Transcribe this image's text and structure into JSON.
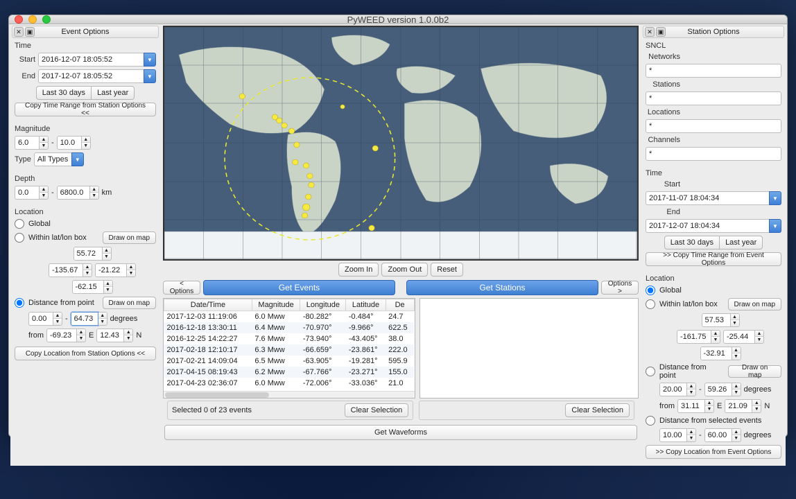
{
  "window": {
    "title": "PyWEED version 1.0.0b2"
  },
  "event": {
    "panel_title": "Event Options",
    "time_title": "Time",
    "start_label": "Start",
    "start_value": "2016-12-07 18:05:52",
    "end_label": "End",
    "end_value": "2017-12-07 18:05:52",
    "last30": "Last 30 days",
    "lastyear": "Last year",
    "copy_time": "Copy Time Range from Station Options <<",
    "mag_title": "Magnitude",
    "mag_min": "6.0",
    "mag_max": "10.0",
    "type_label": "Type",
    "type_value": "All Types",
    "depth_title": "Depth",
    "depth_min": "0.0",
    "depth_max": "6800.0",
    "depth_unit": "km",
    "loc_title": "Location",
    "global": "Global",
    "within": "Within lat/lon box",
    "draw": "Draw on map",
    "box_n": "55.72",
    "box_w": "-135.67",
    "box_e": "-21.22",
    "box_s": "-62.15",
    "dist_label": "Distance from point",
    "dist_min": "0.00",
    "dist_max": "64.73",
    "degrees": "degrees",
    "from": "from",
    "lat": "-69.23",
    "lon": "12.43",
    "E": "E",
    "N": "N",
    "copy_loc": "Copy Location from Station Options <<",
    "dash": "-"
  },
  "center": {
    "zoom_in": "Zoom In",
    "zoom_out": "Zoom Out",
    "reset": "Reset",
    "options_l": "< Options",
    "options_r": "Options >",
    "get_events": "Get Events",
    "get_stations": "Get Stations",
    "headers": [
      "Date/Time",
      "Magnitude",
      "Longitude",
      "Latitude",
      "De"
    ],
    "rows": [
      [
        "2017-12-03 11:19:06",
        "6.0 Mww",
        "-80.282°",
        "-0.484°",
        "24.7"
      ],
      [
        "2016-12-18 13:30:11",
        "6.4 Mww",
        "-70.970°",
        "-9.966°",
        "622.5"
      ],
      [
        "2016-12-25 14:22:27",
        "7.6 Mww",
        "-73.940°",
        "-43.405°",
        "38.0"
      ],
      [
        "2017-02-18 12:10:17",
        "6.3 Mww",
        "-66.659°",
        "-23.861°",
        "222.0"
      ],
      [
        "2017-02-21 14:09:04",
        "6.5 Mww",
        "-63.905°",
        "-19.281°",
        "595.9"
      ],
      [
        "2017-04-15 08:19:43",
        "6.2 Mww",
        "-67.766°",
        "-23.271°",
        "155.0"
      ],
      [
        "2017-04-23 02:36:07",
        "6.0 Mww",
        "-72.006°",
        "-33.036°",
        "21.0"
      ]
    ],
    "selected": "Selected 0 of 23 events",
    "clear": "Clear Selection",
    "get_wave": "Get Waveforms"
  },
  "station": {
    "panel_title": "Station Options",
    "sncl_title": "SNCL",
    "networks": "Networks",
    "networks_v": "*",
    "stations": "Stations",
    "stations_v": "*",
    "locations": "Locations",
    "locations_v": "*",
    "channels": "Channels",
    "channels_v": "*",
    "time_title": "Time",
    "start_label": "Start",
    "start_value": "2017-11-07 18:04:34",
    "end_label": "End",
    "end_value": "2017-12-07 18:04:34",
    "last30": "Last 30 days",
    "lastyear": "Last year",
    "copy_time": ">> Copy Time Range from Event Options",
    "loc_title": "Location",
    "global": "Global",
    "within": "Within lat/lon box",
    "draw": "Draw on map",
    "box_n": "57.53",
    "box_w": "-161.75",
    "box_e": "-25.44",
    "box_s": "-32.91",
    "dist_label": "Distance from point",
    "dist_min": "20.00",
    "dist_max": "59.26",
    "degrees": "degrees",
    "from": "from",
    "lat": "31.11",
    "lon": "21.09",
    "E": "E",
    "N": "N",
    "dsel_label": "Distance from selected events",
    "dsel_min": "10.00",
    "dsel_max": "60.00",
    "copy_loc": ">> Copy Location from Event Options",
    "dash": "-"
  }
}
